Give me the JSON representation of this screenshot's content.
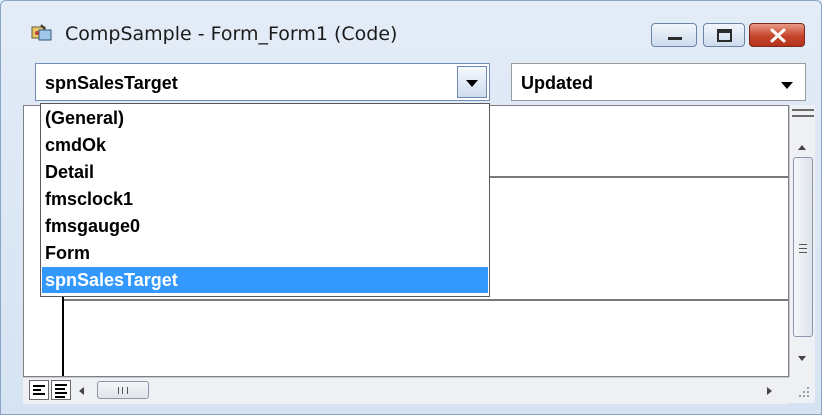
{
  "window": {
    "title": "CompSample - Form_Form1 (Code)",
    "icon": "vba-project-icon",
    "controls": [
      "minimize-icon",
      "maximize-icon",
      "close-icon"
    ]
  },
  "object_combo": {
    "value": "spnSalesTarget",
    "options": [
      "(General)",
      "cmdOk",
      "Detail",
      "fmsclock1",
      "fmsgauge0",
      "Form",
      "spnSalesTarget"
    ],
    "selected_index": 6,
    "expanded": true
  },
  "procedure_combo": {
    "value": "Updated"
  },
  "colors": {
    "selection": "#3399ff",
    "close_button": "#c5452c",
    "window_frame": "#dfe9f5"
  },
  "bottom_bar": {
    "view_buttons": [
      "procedure-view-icon",
      "full-module-view-icon"
    ],
    "scroll_left_icon": "chevron-left-icon",
    "scroll_right_icon": "chevron-right-icon"
  }
}
